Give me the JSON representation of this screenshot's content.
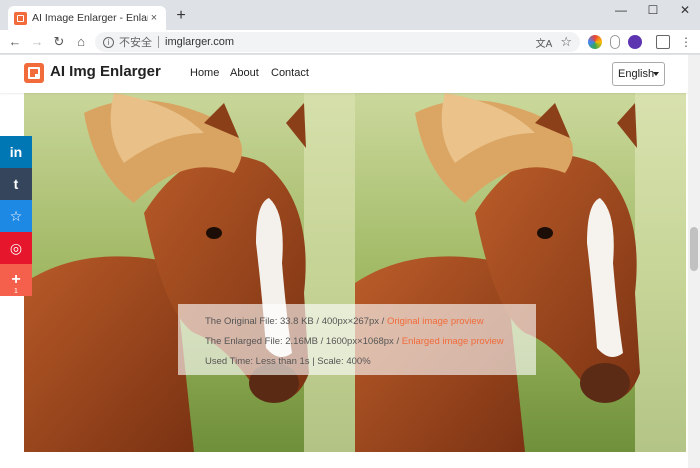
{
  "browser": {
    "tab_title": "AI Image Enlarger - Enlarge Im",
    "tab_close": "×",
    "new_tab": "+",
    "win_min": "—",
    "win_max": "☐",
    "win_close": "✕",
    "security_label": "不安全",
    "url": "imglarger.com",
    "info_glyph": "i"
  },
  "site": {
    "logo": "AI Img Enlarger",
    "nav": [
      "Home",
      "About",
      "Contact"
    ],
    "language": "English"
  },
  "info": {
    "original_text": "The Original File: 33.8 KB / 400px×267px / ",
    "original_link": "Original image proview",
    "enlarged_text": "The Enlarged File: 2.16MB / 1600px×1068px / ",
    "enlarged_link": "Enlarged image proview",
    "time_text": "Used Time: Less than 1s | Scale: 400%"
  },
  "share": {
    "items": [
      {
        "label": "in",
        "icon": "linkedin-icon",
        "color": "#0077b5"
      },
      {
        "label": "t",
        "icon": "tumblr-icon",
        "color": "#35465c"
      },
      {
        "label": "☆",
        "icon": "favorite-icon",
        "color": "#1e88e5"
      },
      {
        "label": "◎",
        "icon": "weibo-icon",
        "color": "#e6162d"
      },
      {
        "label": "+",
        "icon": "plus-icon",
        "color": "#f4604c"
      }
    ],
    "count": "1"
  }
}
